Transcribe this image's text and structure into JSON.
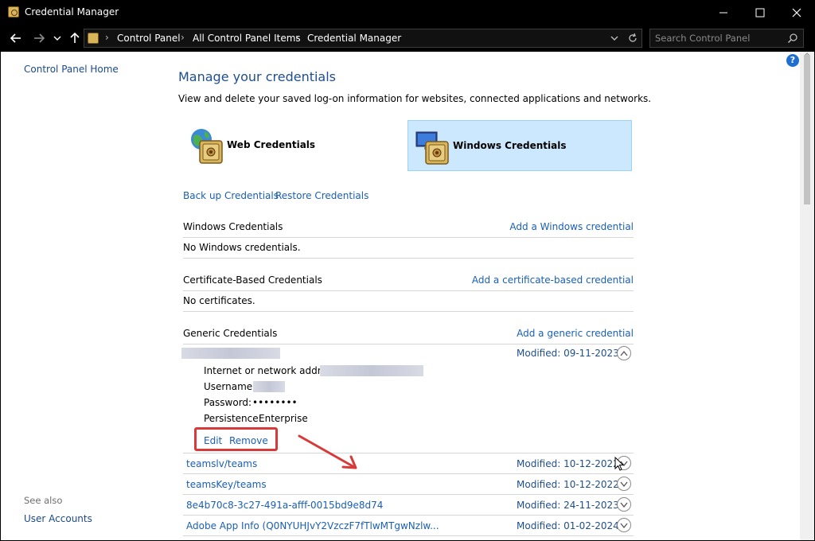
{
  "window": {
    "title": "Credential Manager",
    "min_glyph": "—",
    "max_glyph": "☐",
    "close_glyph": "✕"
  },
  "address": {
    "crumbs": [
      "Control Panel",
      "All Control Panel Items",
      "Credential Manager"
    ],
    "separator": "›",
    "search_placeholder": "Search Control Panel"
  },
  "sidebar": {
    "home": "Control Panel Home",
    "see_also": "See also",
    "user_accounts": "User Accounts"
  },
  "main": {
    "help": "?",
    "title": "Manage your credentials",
    "description": "View and delete your saved log-on information for websites, connected applications and networks.",
    "tiles": {
      "web": "Web Credentials",
      "windows": "Windows Credentials",
      "selected": "windows"
    },
    "backup": "Back up Credentials",
    "restore": "Restore Credentials",
    "sections": {
      "windows": {
        "title": "Windows Credentials",
        "add": "Add a Windows credential",
        "empty": "No Windows credentials."
      },
      "certificate": {
        "title": "Certificate-Based Credentials",
        "add": "Add a certificate-based credential",
        "empty": "No certificates."
      },
      "generic": {
        "title": "Generic Credentials",
        "add": "Add a generic credential"
      }
    },
    "expanded": {
      "modified": "Modified:  09-11-2023",
      "address_label": "Internet or network address:",
      "username_label": "Username:",
      "password_label": "Password:",
      "password_value": "••••••••",
      "persistence_label": "Persistence:",
      "persistence_value": "Enterprise",
      "edit": "Edit",
      "remove": "Remove"
    },
    "rows": [
      {
        "name": "teamslv/teams",
        "modified": "Modified:  10-12-2022"
      },
      {
        "name": "teamsKey/teams",
        "modified": "Modified:  10-12-2022"
      },
      {
        "name": "8e4b70c8-3c27-491a-afff-0015bd9e8d74",
        "modified": "Modified:  24-11-2023"
      },
      {
        "name": "Adobe App Info (Q0NYUHJvY2VzczF7fTlwMTgwNzlw...",
        "modified": "Modified:  01-02-2024"
      }
    ]
  },
  "colors": {
    "link": "#1a5fb4",
    "title_blue": "#1f4e8c",
    "selected_tile": "#cce8ff",
    "annotation_red": "#d83a3a"
  }
}
